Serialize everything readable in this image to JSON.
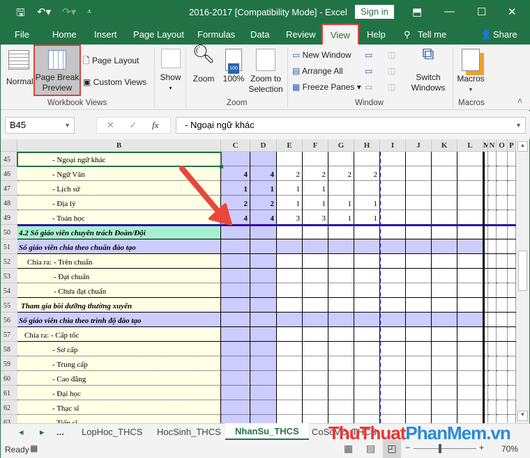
{
  "titlebar": {
    "title": "2016-2017  [Compatibility Mode]  -  Excel",
    "sign_in": "Sign in"
  },
  "menu": [
    "File",
    "Home",
    "Insert",
    "Page Layout",
    "Formulas",
    "Data",
    "Review",
    "View",
    "Help",
    "Tell me",
    "Share"
  ],
  "ribbon": {
    "normal": "Normal",
    "page_break_preview": "Page Break Preview",
    "page_layout": "Page Layout",
    "custom_views": "Custom Views",
    "workbook_views": "Workbook Views",
    "show": "Show",
    "zoom": "Zoom",
    "zoom100": "100%",
    "zoom_to_selection": "Zoom to Selection",
    "zoom_group": "Zoom",
    "new_window": "New Window",
    "arrange_all": "Arrange All",
    "freeze_panes": "Freeze Panes",
    "switch_windows": "Switch Windows",
    "window_group": "Window",
    "macros": "Macros",
    "macros_group": "Macros"
  },
  "formula_bar": {
    "name_box": "B45",
    "fx": "fx",
    "value": "- Ngoại ngữ khác"
  },
  "columns": [
    "B",
    "C",
    "D",
    "E",
    "F",
    "G",
    "H",
    "I",
    "J",
    "K",
    "L",
    "M",
    "N",
    "O",
    "P"
  ],
  "rows": [
    {
      "n": "45",
      "b": "- Ngoại ngữ khác",
      "ind": 50,
      "v": [
        "",
        "",
        "",
        "",
        "",
        ""
      ]
    },
    {
      "n": "46",
      "b": "- Ngữ Văn",
      "ind": 50,
      "v": [
        "4",
        "4",
        "2",
        "2",
        "2",
        "2"
      ]
    },
    {
      "n": "47",
      "b": "- Lịch sử",
      "ind": 50,
      "v": [
        "1",
        "1",
        "1",
        "1",
        "",
        ""
      ]
    },
    {
      "n": "48",
      "b": "- Địa lý",
      "ind": 50,
      "v": [
        "2",
        "2",
        "1",
        "1",
        "1",
        "1"
      ]
    },
    {
      "n": "49",
      "b": "- Toán học",
      "ind": 50,
      "v": [
        "4",
        "4",
        "3",
        "3",
        "1",
        "1"
      ]
    },
    {
      "n": "50",
      "b": "4.2 Số giáo viên chuyên trách Đoàn/Đội",
      "ind": 2,
      "style": "mint",
      "v": [
        "",
        "",
        "",
        "",
        "",
        ""
      ]
    },
    {
      "n": "51",
      "b": "Số giáo viên chia theo chuẩn đào tạo",
      "ind": 2,
      "style": "lav",
      "v": [
        "",
        "",
        "",
        "",
        "",
        ""
      ]
    },
    {
      "n": "52",
      "b": "Chia ra: - Trên chuẩn",
      "ind": 14,
      "v": [
        "",
        "",
        "",
        "",
        "",
        ""
      ]
    },
    {
      "n": "53",
      "b": "- Đạt chuẩn",
      "ind": 52,
      "v": [
        "",
        "",
        "",
        "",
        "",
        ""
      ]
    },
    {
      "n": "54",
      "b": "- Chưa đạt chuẩn",
      "ind": 52,
      "v": [
        "",
        "",
        "",
        "",
        "",
        ""
      ]
    },
    {
      "n": "55",
      "b": "Tham gia bồi dưỡng thường xuyên",
      "ind": 5,
      "style": "bi",
      "v": [
        "",
        "",
        "",
        "",
        "",
        ""
      ]
    },
    {
      "n": "56",
      "b": "Số giáo viên chia theo trình độ đào tạo",
      "ind": 2,
      "style": "lav",
      "v": [
        "",
        "",
        "",
        "",
        "",
        ""
      ]
    },
    {
      "n": "57",
      "b": "Chia ra: - Cấp tốc",
      "ind": 10,
      "v": [
        "",
        "",
        "",
        "",
        "",
        ""
      ]
    },
    {
      "n": "58",
      "b": "- Sơ cấp",
      "ind": 50,
      "v": [
        "",
        "",
        "",
        "",
        "",
        ""
      ]
    },
    {
      "n": "59",
      "b": "- Trung cấp",
      "ind": 50,
      "v": [
        "",
        "",
        "",
        "",
        "",
        ""
      ]
    },
    {
      "n": "60",
      "b": "- Cao đẳng",
      "ind": 50,
      "v": [
        "",
        "",
        "",
        "",
        "",
        ""
      ]
    },
    {
      "n": "61",
      "b": "- Đại học",
      "ind": 50,
      "v": [
        "",
        "",
        "",
        "",
        "",
        ""
      ]
    },
    {
      "n": "62",
      "b": "- Thạc sĩ",
      "ind": 50,
      "v": [
        "",
        "",
        "",
        "",
        "",
        ""
      ]
    },
    {
      "n": "63",
      "b": "- Tiến sĩ",
      "ind": 50,
      "v": [
        "",
        "",
        "",
        "",
        "",
        ""
      ]
    }
  ],
  "sheet_tabs": {
    "more": "...",
    "tabs": [
      "LopHoc_THCS",
      "HocSinh_THCS",
      "NhanSu_THCS",
      "CoSoVC_THCS"
    ],
    "active": "NhanSu_THCS"
  },
  "status": {
    "ready": "Ready",
    "zoom": "70%",
    "zoom_fraction": 0.7
  },
  "watermark": "ThuThuatPhanMem.vn",
  "colors": {
    "excel_green": "#217346",
    "highlight_red": "#d9443c",
    "lavender": "#ccccff",
    "cream": "#ffffe5",
    "mint": "#a6f0cf",
    "page_break": "#2b10a8"
  }
}
